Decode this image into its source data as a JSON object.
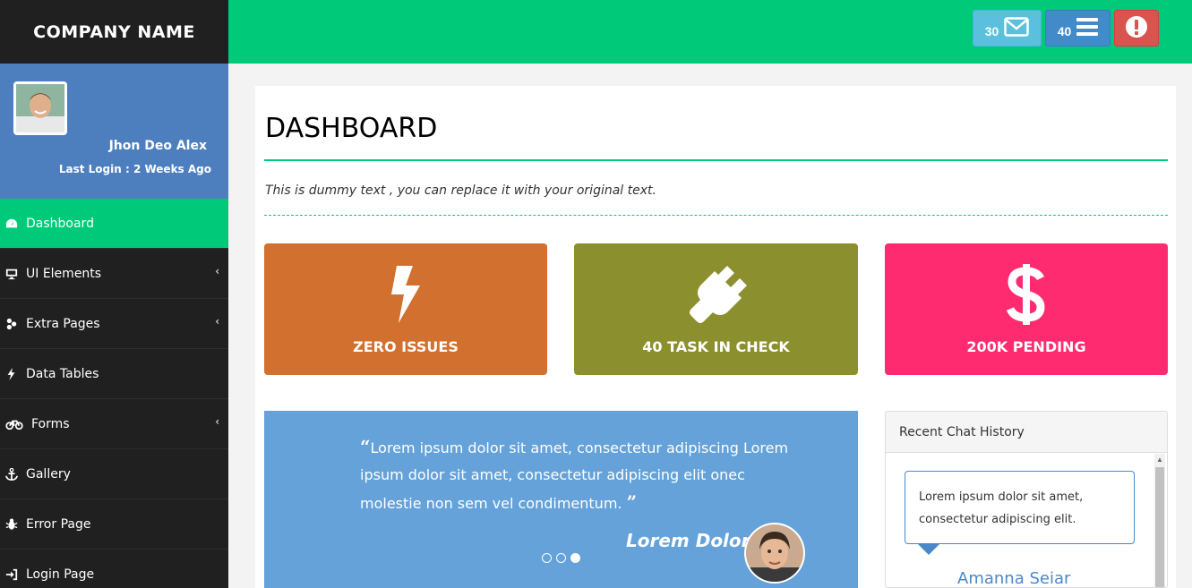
{
  "brand": {
    "name": "COMPANY NAME"
  },
  "header": {
    "mail": {
      "count": "30",
      "icon": "envelope-icon"
    },
    "tasks": {
      "count": "40",
      "icon": "bars-icon"
    },
    "alert": {
      "icon": "exclamation-circle-icon"
    }
  },
  "profile": {
    "name": "Jhon Deo Alex",
    "last_login": "Last Login : 2 Weeks Ago"
  },
  "sidebar": {
    "items": [
      {
        "label": "Dashboard",
        "icon": "dashboard-icon",
        "active": true
      },
      {
        "label": "UI Elements",
        "icon": "desktop-icon",
        "submenu": true
      },
      {
        "label": "Extra Pages",
        "icon": "puzzle-icon",
        "submenu": true
      },
      {
        "label": "Data Tables",
        "icon": "bolt-icon"
      },
      {
        "label": "Forms",
        "icon": "bicycle-icon",
        "submenu": true
      },
      {
        "label": "Gallery",
        "icon": "anchor-icon"
      },
      {
        "label": "Error Page",
        "icon": "bug-icon"
      },
      {
        "label": "Login Page",
        "icon": "sign-in-icon"
      }
    ]
  },
  "page": {
    "title": "DASHBOARD",
    "subtitle": "This is dummy text , you can replace it with your original text."
  },
  "stats": [
    {
      "label": "ZERO ISSUES",
      "icon": "bolt-icon",
      "color": "#d2702f"
    },
    {
      "label": "40 TASK IN CHECK",
      "icon": "plug-icon",
      "color": "#8b8f2e"
    },
    {
      "label": "200K PENDING",
      "icon": "dollar-icon",
      "color": "#ff2b70"
    }
  ],
  "testimonial": {
    "text": "Lorem ipsum dolor sit amet, consectetur adipiscing Lorem ipsum dolor sit amet, consectetur adipiscing elit onec molestie non sem vel condimentum.",
    "author": "Lorem Dolor",
    "slides": 3,
    "active_slide": 3
  },
  "chat": {
    "title": "Recent Chat History",
    "message": "Lorem ipsum dolor sit amet, consectetur adipiscing elit.",
    "author": "Amanna Seiar"
  }
}
